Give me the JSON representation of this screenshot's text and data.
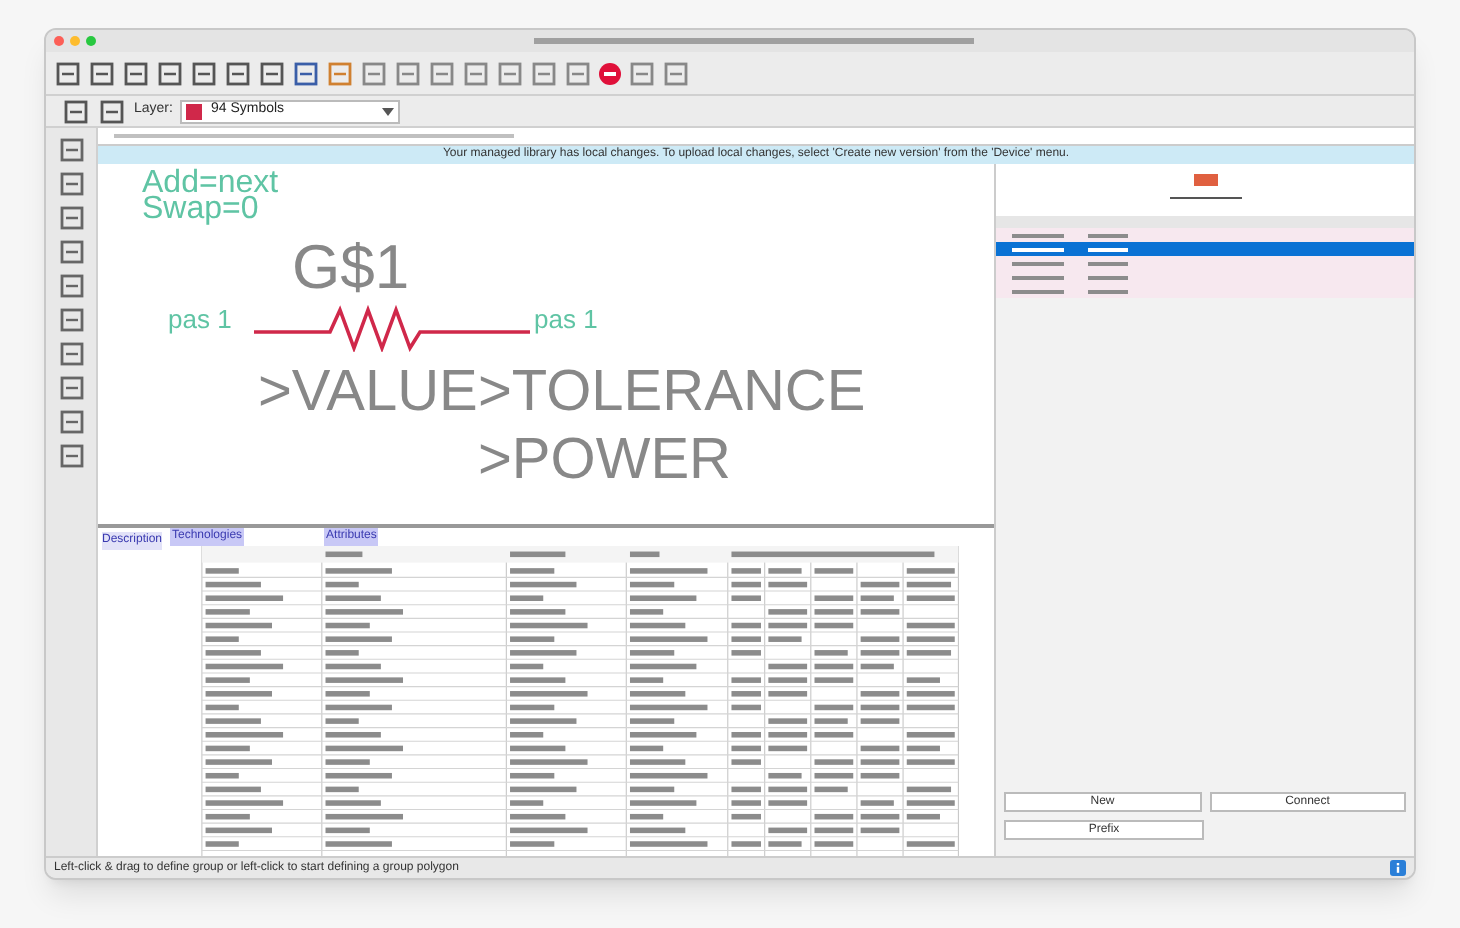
{
  "layer": {
    "label": "Layer:",
    "value": "94 Symbols",
    "color": "#d0284a"
  },
  "info_bar": {
    "text": "Your managed library has local changes. To upload local changes, select 'Create new version' from the 'Device' menu."
  },
  "symbol": {
    "attribute_lines": [
      "Add=next",
      "Swap=0"
    ],
    "name": "G$1",
    "pins": [
      "pas 1",
      "pas 1"
    ],
    "attribute_labels": [
      ">VALUE",
      ">TOLERANCE",
      ">POWER"
    ]
  },
  "details": {
    "side_label": "Description",
    "headers": [
      "Technologies",
      "Attributes"
    ]
  },
  "package_rows": [
    {
      "selected": false
    },
    {
      "selected": true
    },
    {
      "selected": false
    },
    {
      "selected": false
    },
    {
      "selected": false
    }
  ],
  "buttons": [
    "New",
    "Connect",
    "Prefix"
  ],
  "status_bar": "Left-click & drag to define group or left-click to start defining a group polygon"
}
